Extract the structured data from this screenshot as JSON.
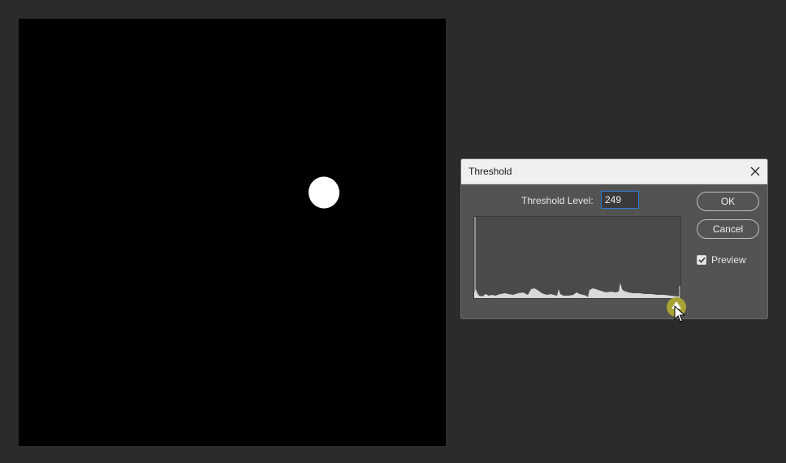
{
  "canvas": {
    "background": "#000000",
    "shape_color": "#ffffff"
  },
  "dialog": {
    "title": "Threshold",
    "threshold_label": "Threshold Level:",
    "threshold_value": "249",
    "ok_label": "OK",
    "cancel_label": "Cancel",
    "preview_label": "Preview",
    "preview_checked": true,
    "slider_value": 249,
    "slider_color": "#a6a334"
  }
}
